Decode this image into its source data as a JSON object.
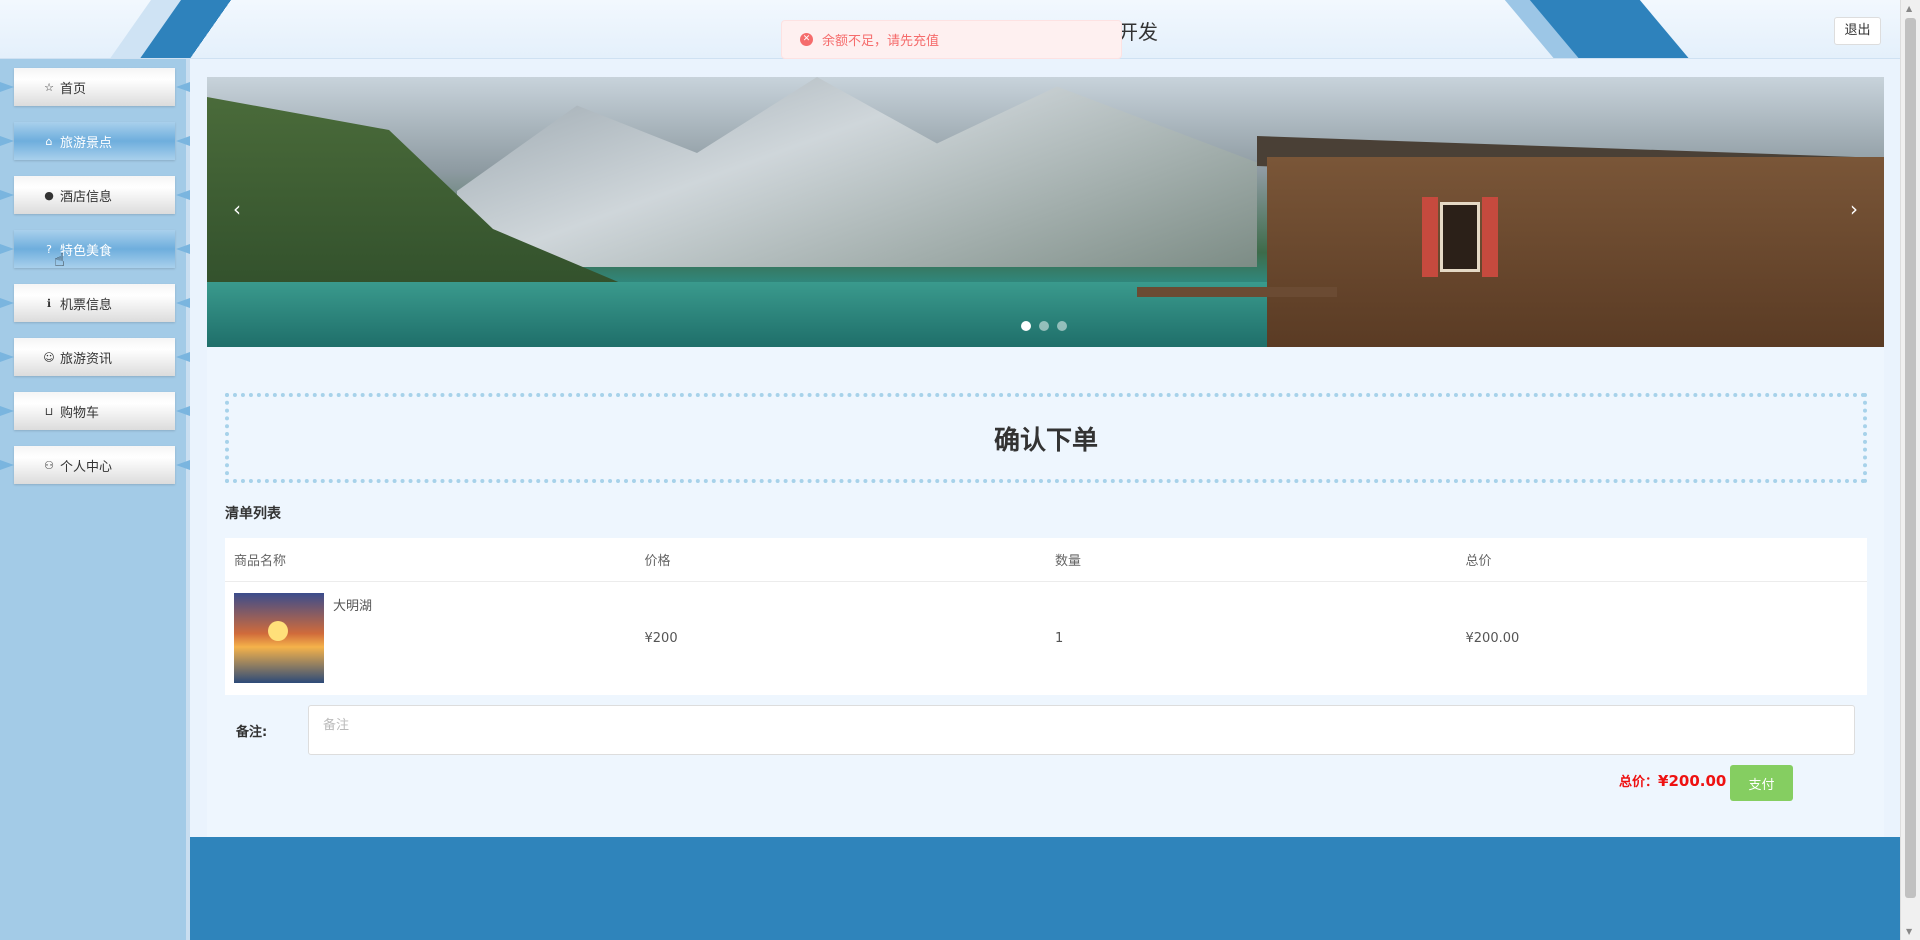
{
  "header": {
    "site_title": "开发",
    "logout_label": "退出"
  },
  "toast": {
    "message": "余额不足，请先充值"
  },
  "sidebar": {
    "items": [
      {
        "label": "首页",
        "icon": "star-icon"
      },
      {
        "label": "旅游景点",
        "icon": "lock-icon"
      },
      {
        "label": "酒店信息",
        "icon": "alert-icon"
      },
      {
        "label": "特色美食",
        "icon": "help-icon"
      },
      {
        "label": "机票信息",
        "icon": "info-icon"
      },
      {
        "label": "旅游资讯",
        "icon": "smile-icon"
      },
      {
        "label": "购物车",
        "icon": "cart-icon"
      },
      {
        "label": "个人中心",
        "icon": "user-icon"
      }
    ]
  },
  "banner": {
    "prev": "‹",
    "next": "›",
    "slide_count": 3,
    "active_slide": 1
  },
  "order": {
    "title": "确认下单",
    "list_label": "清单列表",
    "columns": [
      "商品名称",
      "价格",
      "数量",
      "总价"
    ],
    "rows": [
      {
        "name": "大明湖",
        "price": "¥200",
        "quantity": "1",
        "total": "¥200.00"
      }
    ],
    "remark_label": "备注:",
    "remark_placeholder": "备注",
    "total_label": "总价：",
    "total_amount": "¥200.00",
    "pay_label": "支付"
  }
}
